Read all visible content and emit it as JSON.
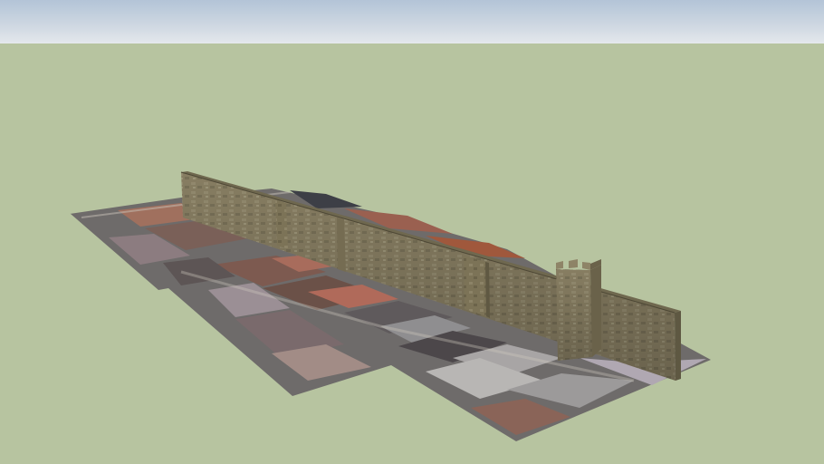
{
  "scene": {
    "sky_color": "#cdd7e2",
    "ground_color": "#b7c4a0",
    "wall_color": "#8c8266",
    "tower_color": "#8b7d60",
    "terrain_base_color": "#6e6b6a"
  }
}
